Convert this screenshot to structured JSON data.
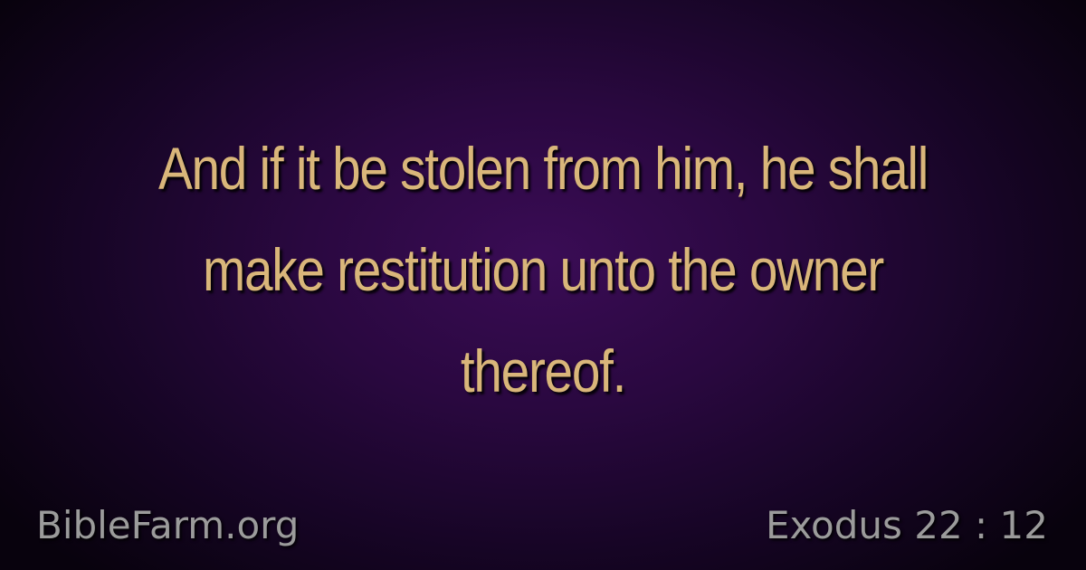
{
  "verse": {
    "text": "And if it be stolen from him, he shall make restitution unto the owner thereof."
  },
  "footer": {
    "site": "BibleFarm.org",
    "reference": "Exodus 22 : 12"
  },
  "colors": {
    "verse_text": "#d9b67a",
    "footer_text": "#9b9b9b",
    "background_center": "#3a0c55",
    "background_edge": "#08020d"
  }
}
